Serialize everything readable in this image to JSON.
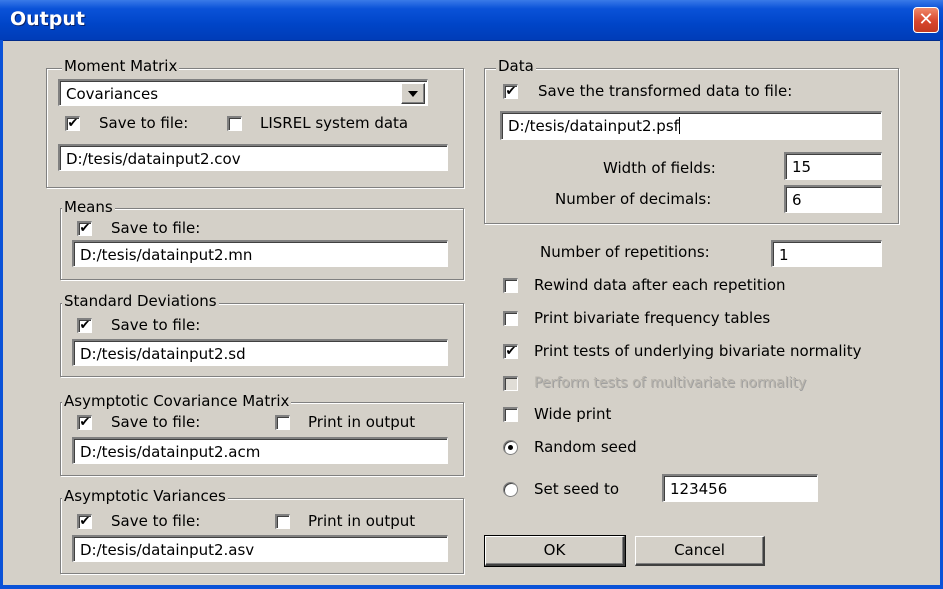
{
  "window": {
    "title": "Output",
    "close_glyph": "✕"
  },
  "moment_matrix": {
    "legend": "Moment Matrix",
    "type_selected": "Covariances",
    "save_checked": true,
    "save_label": "Save to file:",
    "lisrel_checked": false,
    "lisrel_label": "LISREL system data",
    "file_path": "D:/tesis/datainput2.cov"
  },
  "means": {
    "legend": "Means",
    "save_checked": true,
    "save_label": "Save to file:",
    "file_path": "D:/tesis/datainput2.mn"
  },
  "std_devs": {
    "legend": "Standard Deviations",
    "save_checked": true,
    "save_label": "Save to file:",
    "file_path": "D:/tesis/datainput2.sd"
  },
  "acov_matrix": {
    "legend": "Asymptotic Covariance Matrix",
    "save_checked": true,
    "save_label": "Save to file:",
    "print_checked": false,
    "print_label": "Print in output",
    "file_path": "D:/tesis/datainput2.acm"
  },
  "avariances": {
    "legend": "Asymptotic Variances",
    "save_checked": true,
    "save_label": "Save to file:",
    "print_checked": false,
    "print_label": "Print in output",
    "file_path": "D:/tesis/datainput2.asv"
  },
  "data": {
    "legend": "Data",
    "save_checked": true,
    "save_label": "Save the transformed data to file:",
    "file_path": "D:/tesis/datainput2.psf",
    "width_label": "Width of fields:",
    "width_value": "15",
    "decimals_label": "Number of decimals:",
    "decimals_value": "6"
  },
  "options": {
    "repetitions_label": "Number of repetitions:",
    "repetitions_value": "1",
    "rewind_label": "Rewind data after each repetition",
    "rewind_checked": false,
    "bivariate_freq_label": "Print bivariate frequency tables",
    "bivariate_freq_checked": false,
    "bivariate_normality_label": "Print tests of underlying bivariate normality",
    "bivariate_normality_checked": true,
    "multivariate_label": "Perform tests of multivariate normality",
    "multivariate_checked": false,
    "multivariate_enabled": false,
    "wide_print_label": "Wide print",
    "wide_print_checked": false,
    "random_seed_label": "Random seed",
    "random_seed_selected": true,
    "set_seed_label": "Set seed to",
    "set_seed_selected": false,
    "seed_value": "123456"
  },
  "buttons": {
    "ok_label": "OK",
    "cancel_label": "Cancel"
  },
  "check_glyph": "✔",
  "colors": {
    "titlebar": "#0a52d8",
    "dialog_bg": "#d4d0c8",
    "close_button": "#d8462c"
  }
}
